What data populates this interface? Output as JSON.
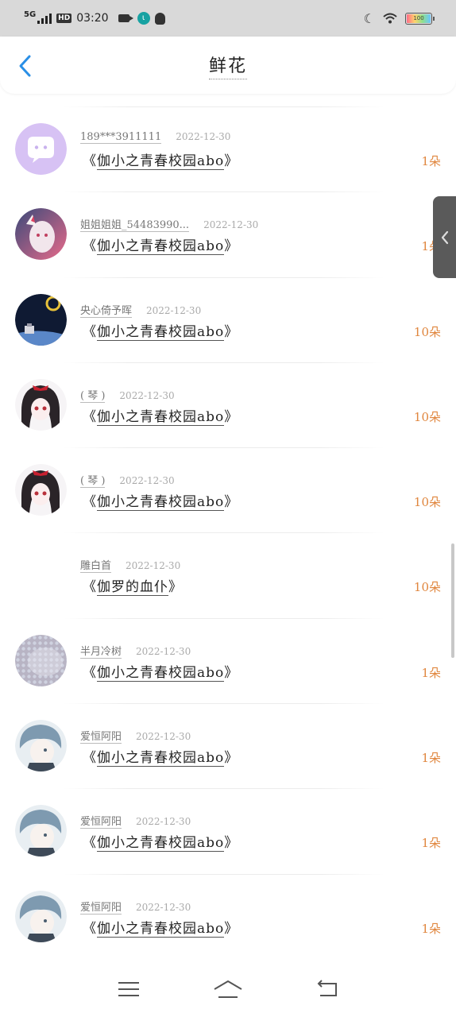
{
  "status_bar": {
    "network": "5G",
    "hd": "HD",
    "time": "03:20",
    "app_badge": "ι",
    "battery": "100"
  },
  "header": {
    "title": "鲜花"
  },
  "rows": [
    {
      "user": "189***3911111",
      "date": "2022-12-30",
      "book_open": "《",
      "book_title": "伽小之青春校园abo",
      "book_close": "》",
      "amount": "1朵"
    },
    {
      "user": "姐姐姐姐_54483990...",
      "date": "2022-12-30",
      "book_open": "《",
      "book_title": "伽小之青春校园abo",
      "book_close": "》",
      "amount": "1朵"
    },
    {
      "user": "央心倚予晖",
      "date": "2022-12-30",
      "book_open": "《",
      "book_title": "伽小之青春校园abo",
      "book_close": "》",
      "amount": "10朵"
    },
    {
      "user": "( 琴 )",
      "date": "2022-12-30",
      "book_open": "《",
      "book_title": "伽小之青春校园abo",
      "book_close": "》",
      "amount": "10朵"
    },
    {
      "user": "( 琴 )",
      "date": "2022-12-30",
      "book_open": "《",
      "book_title": "伽小之青春校园abo",
      "book_close": "》",
      "amount": "10朵"
    },
    {
      "user": "雕白首",
      "date": "2022-12-30",
      "book_open": "《",
      "book_title": "伽罗的血仆",
      "book_close": "》",
      "amount": "10朵"
    },
    {
      "user": "半月冷树",
      "date": "2022-12-30",
      "book_open": "《",
      "book_title": "伽小之青春校园abo",
      "book_close": "》",
      "amount": "1朵"
    },
    {
      "user": "爱恒阿阳",
      "date": "2022-12-30",
      "book_open": "《",
      "book_title": "伽小之青春校园abo",
      "book_close": "》",
      "amount": "1朵"
    },
    {
      "user": "爱恒阿阳",
      "date": "2022-12-30",
      "book_open": "《",
      "book_title": "伽小之青春校园abo",
      "book_close": "》",
      "amount": "1朵"
    },
    {
      "user": "爱恒阿阳",
      "date": "2022-12-30",
      "book_open": "《",
      "book_title": "伽小之青春校园abo",
      "book_close": "》",
      "amount": "1朵"
    }
  ],
  "colors": {
    "accent": "#2a8fe6",
    "amount": "#e0863e",
    "status_bar": "#d9d9d9"
  },
  "icons": {
    "back": "chevron-left-icon",
    "side_tab": "chevron-left-icon",
    "nav_menu": "menu-icon",
    "nav_home": "home-icon",
    "nav_back": "back-arrow-icon"
  }
}
